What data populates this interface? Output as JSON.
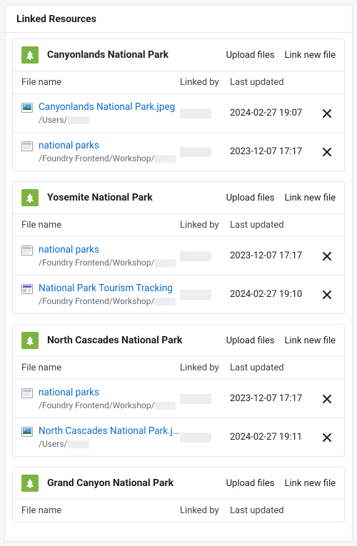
{
  "panel_title": "Linked Resources",
  "action_upload": "Upload files",
  "action_linknew": "Link new file",
  "col_filename": "File name",
  "col_linkedby": "Linked by",
  "col_lastupdated": "Last updated",
  "sections": [
    {
      "title": "Canyonlands National Park",
      "rows": [
        {
          "icon": "image",
          "name": "Canyonlands National Park.jpeg",
          "path": "/Users/",
          "updated": "2024-02-27 19:07"
        },
        {
          "icon": "workbook",
          "name": "national parks",
          "path": "/Foundry Frontend/Workshop/",
          "updated": "2023-12-07 17:17"
        }
      ]
    },
    {
      "title": "Yosemite National Park",
      "rows": [
        {
          "icon": "workbook",
          "name": "national parks",
          "path": "/Foundry Frontend/Workshop/",
          "updated": "2023-12-07 17:17"
        },
        {
          "icon": "report",
          "name": "National Park Tourism Tracking",
          "path": "/Foundry Frontend/Workshop/",
          "updated": "2024-02-27 19:10"
        }
      ]
    },
    {
      "title": "North Cascades National Park",
      "rows": [
        {
          "icon": "workbook",
          "name": "national parks",
          "path": "/Foundry Frontend/Workshop/",
          "updated": "2023-12-07 17:17"
        },
        {
          "icon": "image",
          "name": "North Cascades National Park.jpeg",
          "path": "/Users/",
          "updated": "2024-02-27 19:11"
        }
      ]
    },
    {
      "title": "Grand Canyon National Park",
      "rows": []
    }
  ]
}
